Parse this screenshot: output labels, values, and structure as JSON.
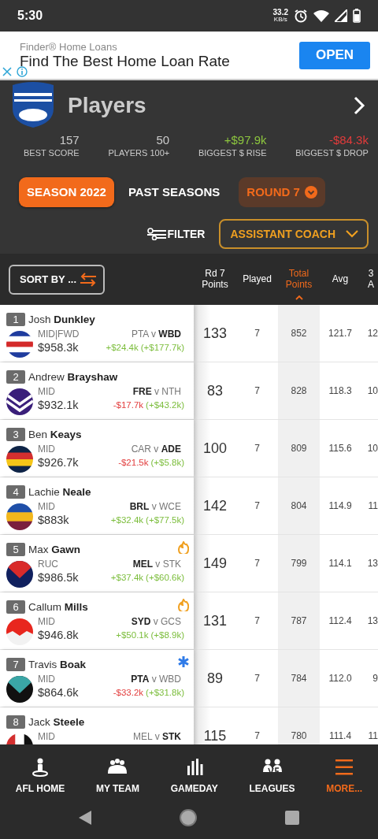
{
  "status_bar": {
    "time": "5:30",
    "speed": "33.2",
    "speed_unit": "KB/s"
  },
  "ad": {
    "source": "Finder® Home Loans",
    "headline": "Find The Best Home Loan Rate",
    "button": "OPEN"
  },
  "header": {
    "title": "Players"
  },
  "summary": [
    {
      "value": "157",
      "label": "BEST SCORE",
      "color": "#cccccc"
    },
    {
      "value": "50",
      "label": "PLAYERS 100+",
      "color": "#cccccc"
    },
    {
      "value": "+$97.9k",
      "label": "BIGGEST $ RISE",
      "color": "#8dc63f"
    },
    {
      "value": "-$84.3k",
      "label": "BIGGEST $ DROP",
      "color": "#e23b3b"
    }
  ],
  "season_tabs": [
    {
      "label": "SEASON 2022",
      "selected": true
    },
    {
      "label": "PAST SEASONS",
      "selected": false
    }
  ],
  "round_select": {
    "label": "ROUND 7"
  },
  "filter": {
    "label": "FILTER"
  },
  "view_select": {
    "label": "ASSISTANT COACH"
  },
  "sort_button": {
    "label": "SORT BY ..."
  },
  "columns": [
    {
      "label": "Rd 7 Points",
      "selected": false
    },
    {
      "label": "Played",
      "selected": false
    },
    {
      "label": "Total Points",
      "selected": true
    },
    {
      "label": "Avg",
      "selected": false
    },
    {
      "label": "3 A",
      "selected": false
    }
  ],
  "players": [
    {
      "rank": "1",
      "name": "Josh **Dunkley**",
      "position": "MID|FWD",
      "price": "$958.3k",
      "fixture": "PTA v **WBD**",
      "change": {
        "text": "+$24.4k",
        "color": "#7bbd3b"
      },
      "season_change": {
        "text": "(+$177.7k)",
        "color": "#7bbd3b"
      },
      "jumper": {
        "kind": "hoops",
        "stripes": [
          {
            "color": "#1f3c9e"
          },
          {
            "color": "#ffffff"
          },
          {
            "color": "#d42a2a"
          },
          {
            "color": "#ffffff"
          },
          {
            "color": "#1f3c9e"
          }
        ]
      },
      "stats": [
        "133",
        "7",
        "852",
        "121.7",
        "12"
      ]
    },
    {
      "rank": "2",
      "name": "Andrew **Brayshaw**",
      "position": "MID",
      "price": "$932.1k",
      "fixture": "**FRE** v NTH",
      "change": {
        "text": "-$17.7k",
        "color": "#e23b3b"
      },
      "season_change": {
        "text": "(+$43.2k)",
        "color": "#7bbd3b"
      },
      "jumper": {
        "kind": "chevron",
        "stripes": [
          {
            "color": "#3a1f7a"
          },
          {
            "color": "#ffffff"
          }
        ]
      },
      "stats": [
        "83",
        "7",
        "828",
        "118.3",
        "10"
      ]
    },
    {
      "rank": "3",
      "name": "Ben **Keays**",
      "position": "MID",
      "price": "$926.7k",
      "fixture": "CAR v **ADE**",
      "change": {
        "text": "-$21.5k",
        "color": "#e23b3b"
      },
      "season_change": {
        "text": "(+$5.8k)",
        "color": "#7bbd3b"
      },
      "jumper": {
        "kind": "hoops",
        "stripes": [
          {
            "color": "#0e2447"
          },
          {
            "color": "#d32f2f"
          },
          {
            "color": "#f5c518"
          },
          {
            "color": "#0e2447"
          }
        ]
      },
      "stats": [
        "100",
        "7",
        "809",
        "115.6",
        "10"
      ]
    },
    {
      "rank": "4",
      "name": "Lachie **Neale**",
      "position": "MID",
      "price": "$883k",
      "fixture": "**BRL** v WCE",
      "change": {
        "text": "+$32.4k",
        "color": "#7bbd3b"
      },
      "season_change": {
        "text": "(+$77.5k)",
        "color": "#7bbd3b"
      },
      "jumper": {
        "kind": "hoops",
        "stripes": [
          {
            "color": "#1f4fa8"
          },
          {
            "color": "#f2b71c"
          },
          {
            "color": "#7a1f3d"
          }
        ]
      },
      "stats": [
        "142",
        "7",
        "804",
        "114.9",
        "11"
      ]
    },
    {
      "rank": "5",
      "name": "Max **Gawn**",
      "position": "RUC",
      "price": "$986.5k",
      "fixture": "**MEL** v STK",
      "change": {
        "text": "+$37.4k",
        "color": "#7bbd3b"
      },
      "season_change": {
        "text": "(+$60.6k)",
        "color": "#7bbd3b"
      },
      "badge": {
        "kind": "fire"
      },
      "jumper": {
        "kind": "vee",
        "stripes": [
          {
            "color": "#10205e"
          },
          {
            "color": "#d92b2b"
          }
        ]
      },
      "stats": [
        "149",
        "7",
        "799",
        "114.1",
        "13"
      ]
    },
    {
      "rank": "6",
      "name": "Callum **Mills**",
      "position": "MID",
      "price": "$946.8k",
      "fixture": "**SYD** v GCS",
      "change": {
        "text": "+$50.1k",
        "color": "#7bbd3b"
      },
      "season_change": {
        "text": "(+$8.9k)",
        "color": "#7bbd3b"
      },
      "badge": {
        "kind": "fire"
      },
      "jumper": {
        "kind": "split",
        "stripes": [
          {
            "color": "#e8261e"
          },
          {
            "color": "#f2f2f2"
          }
        ]
      },
      "stats": [
        "131",
        "7",
        "787",
        "112.4",
        "13"
      ]
    },
    {
      "rank": "7",
      "name": "Travis **Boak**",
      "position": "MID",
      "price": "$864.6k",
      "fixture": "**PTA** v WBD",
      "change": {
        "text": "-$33.2k",
        "color": "#e23b3b"
      },
      "season_change": {
        "text": "(+$31.8k)",
        "color": "#7bbd3b"
      },
      "badge": {
        "kind": "asterisk"
      },
      "jumper": {
        "kind": "vee",
        "stripes": [
          {
            "color": "#111111"
          },
          {
            "color": "#3aa6a6"
          }
        ]
      },
      "stats": [
        "89",
        "7",
        "784",
        "112.0",
        "9"
      ]
    },
    {
      "rank": "8",
      "name": "Jack **Steele**",
      "position": "MID",
      "fixture": "MEL v **STK**",
      "jumper": {
        "kind": "stripes",
        "stripes": [
          {
            "color": "#d32f2f"
          },
          {
            "color": "#ffffff"
          },
          {
            "color": "#111111"
          }
        ]
      },
      "stats": [
        "115",
        "7",
        "780",
        "111.4",
        "11"
      ]
    }
  ],
  "nav": [
    {
      "label": "AFL HOME",
      "kind": "home",
      "selected": false
    },
    {
      "label": "MY TEAM",
      "kind": "team",
      "selected": false
    },
    {
      "label": "GAMEDAY",
      "kind": "gameday",
      "selected": false
    },
    {
      "label": "LEAGUES",
      "kind": "leagues",
      "selected": false
    },
    {
      "label": "MORE...",
      "kind": "more",
      "selected": true
    }
  ]
}
